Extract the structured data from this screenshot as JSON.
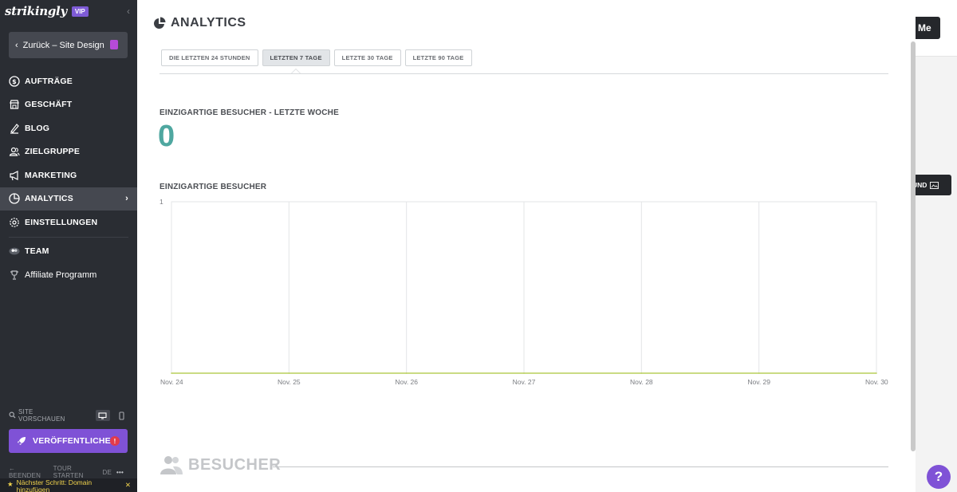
{
  "sidebar": {
    "brand": "strikingly",
    "vip_badge": "VIP",
    "back_button": "Zurück – Site Design",
    "items": [
      {
        "label": "AUFTRÄGE",
        "icon": "dollar-circle-icon"
      },
      {
        "label": "GESCHÄFT",
        "icon": "shop-icon"
      },
      {
        "label": "BLOG",
        "icon": "pen-icon"
      },
      {
        "label": "ZIELGRUPPE",
        "icon": "audience-icon"
      },
      {
        "label": "MARKETING",
        "icon": "megaphone-icon"
      },
      {
        "label": "ANALYTICS",
        "icon": "pie-chart-icon",
        "active": true
      },
      {
        "label": "EINSTELLUNGEN",
        "icon": "gear-icon"
      }
    ],
    "extra_items": [
      {
        "label": "TEAM",
        "icon": "team-icon"
      },
      {
        "label": "Affiliate Programm",
        "icon": "trophy-icon"
      }
    ],
    "preview_label": "SITE VORSCHAUEN",
    "publish_label": "VERÖFFENTLICHEN",
    "publish_badge": "!",
    "bottom_links": {
      "exit": "BEENDEN",
      "tour": "TOUR STARTEN",
      "lang": "DE"
    },
    "next_step": "Nächster Schritt: Domain hinzufügen"
  },
  "background": {
    "top_button": "Me",
    "mid_button": "UND"
  },
  "panel": {
    "title": "ANALYTICS",
    "tabs": [
      {
        "label": "DIE LETZTEN 24 STUNDEN",
        "active": false
      },
      {
        "label": "LETZTEN 7 TAGE",
        "active": true
      },
      {
        "label": "LETZTE 30 TAGE",
        "active": false
      },
      {
        "label": "LETZTE 90 TAGE",
        "active": false
      }
    ],
    "summary_heading": "EINZIGARTIGE BESUCHER - LETZTE WOCHE",
    "summary_value": "0",
    "chart_heading": "EINZIGARTIGE BESUCHER",
    "visitors_heading": "BESUCHER"
  },
  "help": "?",
  "chart_data": {
    "type": "line",
    "x": [
      "Nov. 24",
      "Nov. 25",
      "Nov. 26",
      "Nov. 27",
      "Nov. 28",
      "Nov. 29",
      "Nov. 30"
    ],
    "series": [
      {
        "values": [
          0,
          0,
          0,
          0,
          0,
          0,
          0
        ],
        "color": "#b9cf5a"
      }
    ],
    "y_tick_labels": [
      "1"
    ],
    "ylim": [
      0,
      1
    ],
    "grid": true,
    "title": "",
    "xlabel": "",
    "ylabel": ""
  }
}
